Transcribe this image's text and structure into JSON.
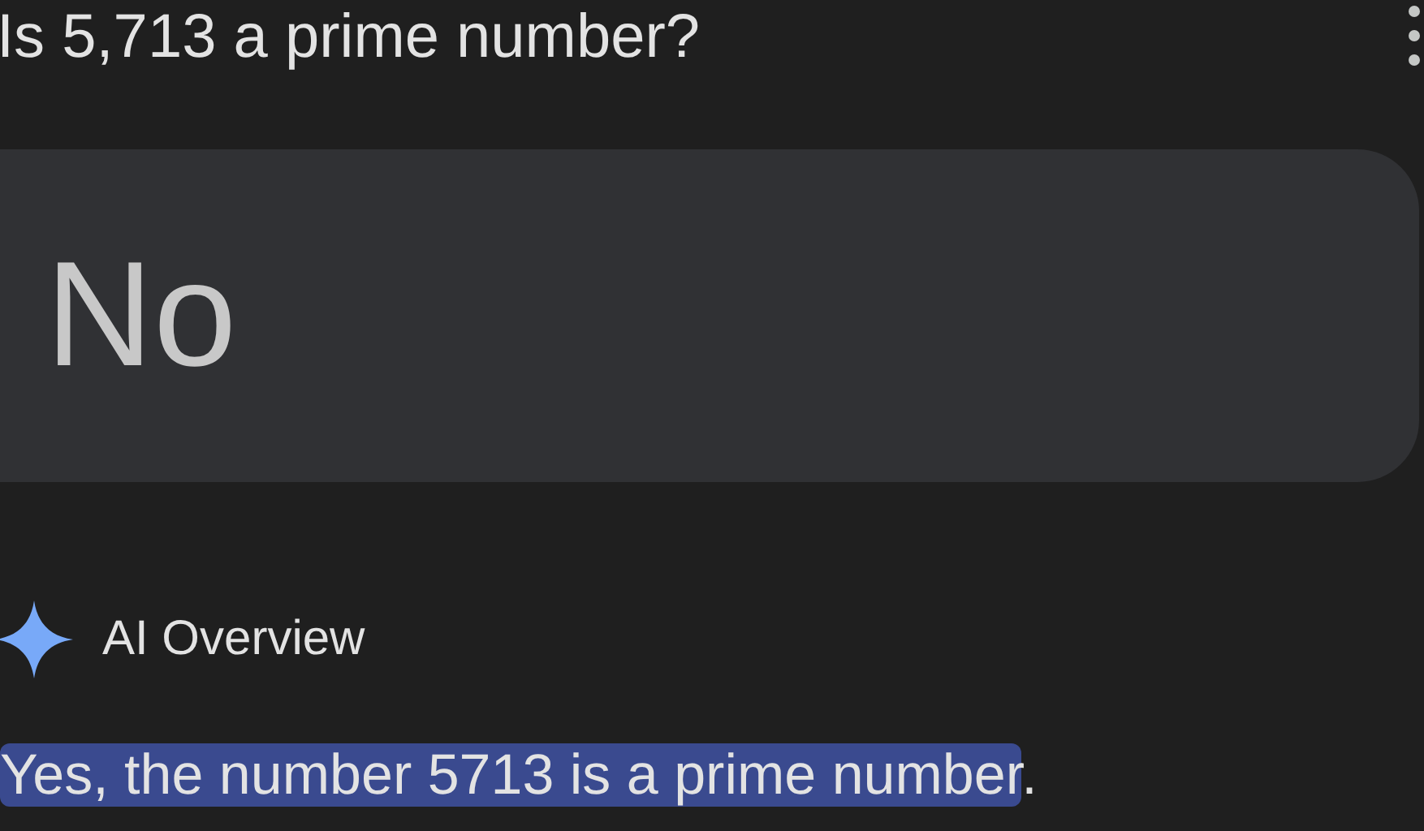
{
  "query": "Is 5,713 a prime number?",
  "answer_card": {
    "text": "No"
  },
  "ai_overview": {
    "label": "AI Overview",
    "answer": {
      "text": "Yes, the number 5713 is a prime number",
      "highlighted": true,
      "trailing": "."
    }
  }
}
